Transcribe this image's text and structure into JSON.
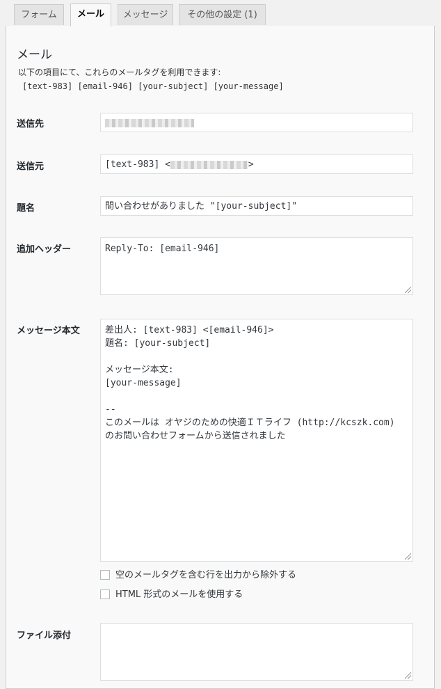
{
  "tabs": [
    {
      "label": "フォーム"
    },
    {
      "label": "メール"
    },
    {
      "label": "メッセージ"
    },
    {
      "label": "その他の設定 (1)"
    }
  ],
  "mail": {
    "title": "メール",
    "intro": "以下の項目にて、これらのメールタグを利用できます:",
    "tags": "[text-983] [email-946] [your-subject] [your-message]"
  },
  "fields": {
    "to": {
      "label": "送信先"
    },
    "from": {
      "label": "送信元",
      "value_prefix": "[text-983] <",
      "value_suffix": ">"
    },
    "subject": {
      "label": "題名",
      "value": "問い合わせがありました \"[your-subject]\""
    },
    "headers": {
      "label": "追加ヘッダー",
      "value": "Reply-To: [email-946]"
    },
    "body": {
      "label": "メッセージ本文",
      "value": "差出人: [text-983] <[email-946]>\n題名: [your-subject]\n\nメッセージ本文:\n[your-message]\n\n--\nこのメールは オヤジのための快適ＩＴライフ (http://kcszk.com)\nのお問い合わせフォームから送信されました"
    },
    "exclude_blank": {
      "label": "空のメールタグを含む行を出力から除外する"
    },
    "use_html": {
      "label": "HTML 形式のメールを使用する"
    },
    "attachments": {
      "label": "ファイル添付",
      "value": ""
    }
  }
}
